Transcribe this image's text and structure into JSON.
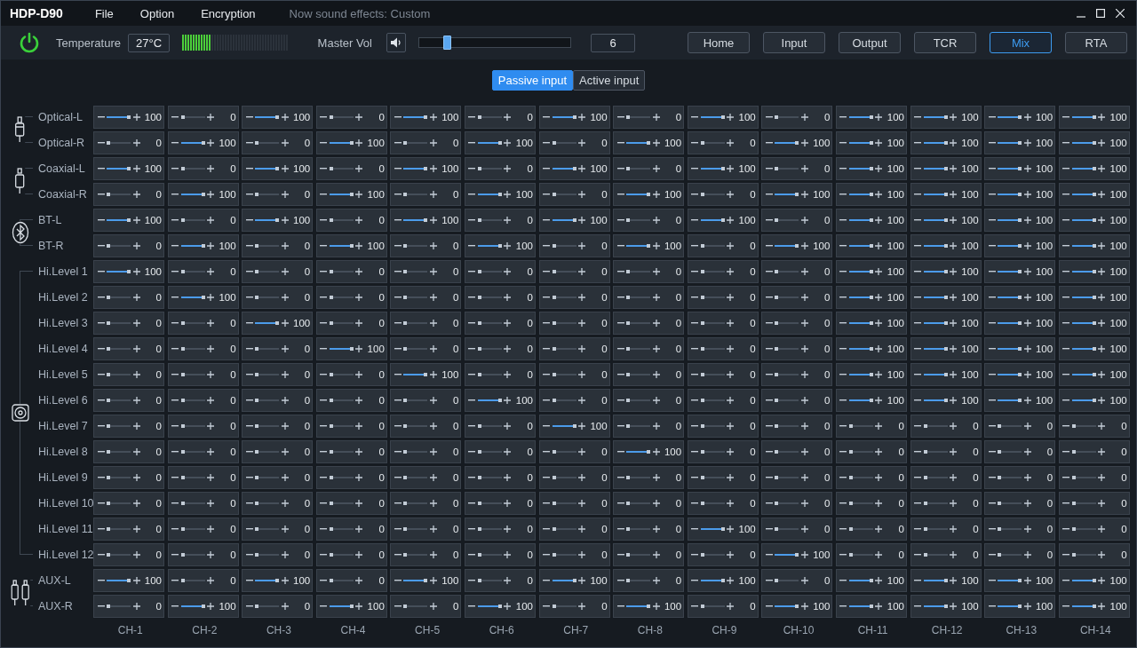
{
  "window": {
    "title": "HDP-D90",
    "menu": [
      "File",
      "Option",
      "Encryption"
    ],
    "status": "Now sound effects: Custom"
  },
  "toolbar": {
    "temperature_label": "Temperature",
    "temperature": "27°C",
    "temperature_meter": {
      "level": 0.27
    },
    "master_label": "Master Vol",
    "master_volume": {
      "level": 0.18,
      "value": "6"
    },
    "nav": [
      {
        "label": "Home",
        "selected": false
      },
      {
        "label": "Input",
        "selected": false
      },
      {
        "label": "Output",
        "selected": false
      },
      {
        "label": "TCR",
        "selected": false
      },
      {
        "label": "Mix",
        "selected": true
      },
      {
        "label": "RTA",
        "selected": false
      }
    ]
  },
  "tabs": [
    {
      "label": "Passive input",
      "selected": true
    },
    {
      "label": "Active input",
      "selected": false
    }
  ],
  "groups": [
    {
      "kind": "optical",
      "rows": [
        {
          "label": "Optical-L",
          "cells": [
            {
              "value": "100",
              "level": 1
            },
            {
              "value": "0",
              "level": 0
            },
            {
              "value": "100",
              "level": 1
            },
            {
              "value": "0",
              "level": 0
            },
            {
              "value": "100",
              "level": 1
            },
            {
              "value": "0",
              "level": 0
            },
            {
              "value": "100",
              "level": 1
            },
            {
              "value": "0",
              "level": 0
            },
            {
              "value": "100",
              "level": 1
            },
            {
              "value": "0",
              "level": 0
            },
            {
              "value": "100",
              "level": 1
            },
            {
              "value": "100",
              "level": 1
            },
            {
              "value": "100",
              "level": 1
            },
            {
              "value": "100",
              "level": 1
            }
          ]
        },
        {
          "label": "Optical-R",
          "cells": [
            {
              "value": "0",
              "level": 0
            },
            {
              "value": "100",
              "level": 1
            },
            {
              "value": "0",
              "level": 0
            },
            {
              "value": "100",
              "level": 1
            },
            {
              "value": "0",
              "level": 0
            },
            {
              "value": "100",
              "level": 1
            },
            {
              "value": "0",
              "level": 0
            },
            {
              "value": "100",
              "level": 1
            },
            {
              "value": "0",
              "level": 0
            },
            {
              "value": "100",
              "level": 1
            },
            {
              "value": "100",
              "level": 1
            },
            {
              "value": "100",
              "level": 1
            },
            {
              "value": "100",
              "level": 1
            },
            {
              "value": "100",
              "level": 1
            }
          ]
        }
      ]
    },
    {
      "kind": "coaxial",
      "rows": [
        {
          "label": "Coaxial-L",
          "cells": [
            {
              "value": "100",
              "level": 1
            },
            {
              "value": "0",
              "level": 0
            },
            {
              "value": "100",
              "level": 1
            },
            {
              "value": "0",
              "level": 0
            },
            {
              "value": "100",
              "level": 1
            },
            {
              "value": "0",
              "level": 0
            },
            {
              "value": "100",
              "level": 1
            },
            {
              "value": "0",
              "level": 0
            },
            {
              "value": "100",
              "level": 1
            },
            {
              "value": "0",
              "level": 0
            },
            {
              "value": "100",
              "level": 1
            },
            {
              "value": "100",
              "level": 1
            },
            {
              "value": "100",
              "level": 1
            },
            {
              "value": "100",
              "level": 1
            }
          ]
        },
        {
          "label": "Coaxial-R",
          "cells": [
            {
              "value": "0",
              "level": 0
            },
            {
              "value": "100",
              "level": 1
            },
            {
              "value": "0",
              "level": 0
            },
            {
              "value": "100",
              "level": 1
            },
            {
              "value": "0",
              "level": 0
            },
            {
              "value": "100",
              "level": 1
            },
            {
              "value": "0",
              "level": 0
            },
            {
              "value": "100",
              "level": 1
            },
            {
              "value": "0",
              "level": 0
            },
            {
              "value": "100",
              "level": 1
            },
            {
              "value": "100",
              "level": 1
            },
            {
              "value": "100",
              "level": 1
            },
            {
              "value": "100",
              "level": 1
            },
            {
              "value": "100",
              "level": 1
            }
          ]
        }
      ]
    },
    {
      "kind": "bluetooth",
      "rows": [
        {
          "label": "BT-L",
          "cells": [
            {
              "value": "100",
              "level": 1
            },
            {
              "value": "0",
              "level": 0
            },
            {
              "value": "100",
              "level": 1
            },
            {
              "value": "0",
              "level": 0
            },
            {
              "value": "100",
              "level": 1
            },
            {
              "value": "0",
              "level": 0
            },
            {
              "value": "100",
              "level": 1
            },
            {
              "value": "0",
              "level": 0
            },
            {
              "value": "100",
              "level": 1
            },
            {
              "value": "0",
              "level": 0
            },
            {
              "value": "100",
              "level": 1
            },
            {
              "value": "100",
              "level": 1
            },
            {
              "value": "100",
              "level": 1
            },
            {
              "value": "100",
              "level": 1
            }
          ]
        },
        {
          "label": "BT-R",
          "cells": [
            {
              "value": "0",
              "level": 0
            },
            {
              "value": "100",
              "level": 1
            },
            {
              "value": "0",
              "level": 0
            },
            {
              "value": "100",
              "level": 1
            },
            {
              "value": "0",
              "level": 0
            },
            {
              "value": "100",
              "level": 1
            },
            {
              "value": "0",
              "level": 0
            },
            {
              "value": "100",
              "level": 1
            },
            {
              "value": "0",
              "level": 0
            },
            {
              "value": "100",
              "level": 1
            },
            {
              "value": "100",
              "level": 1
            },
            {
              "value": "100",
              "level": 1
            },
            {
              "value": "100",
              "level": 1
            },
            {
              "value": "100",
              "level": 1
            }
          ]
        }
      ]
    },
    {
      "kind": "speaker",
      "rows": [
        {
          "label": "Hi.Level 1",
          "cells": [
            {
              "value": "100",
              "level": 1
            },
            {
              "value": "0",
              "level": 0
            },
            {
              "value": "0",
              "level": 0
            },
            {
              "value": "0",
              "level": 0
            },
            {
              "value": "0",
              "level": 0
            },
            {
              "value": "0",
              "level": 0
            },
            {
              "value": "0",
              "level": 0
            },
            {
              "value": "0",
              "level": 0
            },
            {
              "value": "0",
              "level": 0
            },
            {
              "value": "0",
              "level": 0
            },
            {
              "value": "100",
              "level": 1
            },
            {
              "value": "100",
              "level": 1
            },
            {
              "value": "100",
              "level": 1
            },
            {
              "value": "100",
              "level": 1
            }
          ]
        },
        {
          "label": "Hi.Level 2",
          "cells": [
            {
              "value": "0",
              "level": 0
            },
            {
              "value": "100",
              "level": 1
            },
            {
              "value": "0",
              "level": 0
            },
            {
              "value": "0",
              "level": 0
            },
            {
              "value": "0",
              "level": 0
            },
            {
              "value": "0",
              "level": 0
            },
            {
              "value": "0",
              "level": 0
            },
            {
              "value": "0",
              "level": 0
            },
            {
              "value": "0",
              "level": 0
            },
            {
              "value": "0",
              "level": 0
            },
            {
              "value": "100",
              "level": 1
            },
            {
              "value": "100",
              "level": 1
            },
            {
              "value": "100",
              "level": 1
            },
            {
              "value": "100",
              "level": 1
            }
          ]
        },
        {
          "label": "Hi.Level 3",
          "cells": [
            {
              "value": "0",
              "level": 0
            },
            {
              "value": "0",
              "level": 0
            },
            {
              "value": "100",
              "level": 1
            },
            {
              "value": "0",
              "level": 0
            },
            {
              "value": "0",
              "level": 0
            },
            {
              "value": "0",
              "level": 0
            },
            {
              "value": "0",
              "level": 0
            },
            {
              "value": "0",
              "level": 0
            },
            {
              "value": "0",
              "level": 0
            },
            {
              "value": "0",
              "level": 0
            },
            {
              "value": "100",
              "level": 1
            },
            {
              "value": "100",
              "level": 1
            },
            {
              "value": "100",
              "level": 1
            },
            {
              "value": "100",
              "level": 1
            }
          ]
        },
        {
          "label": "Hi.Level 4",
          "cells": [
            {
              "value": "0",
              "level": 0
            },
            {
              "value": "0",
              "level": 0
            },
            {
              "value": "0",
              "level": 0
            },
            {
              "value": "100",
              "level": 1
            },
            {
              "value": "0",
              "level": 0
            },
            {
              "value": "0",
              "level": 0
            },
            {
              "value": "0",
              "level": 0
            },
            {
              "value": "0",
              "level": 0
            },
            {
              "value": "0",
              "level": 0
            },
            {
              "value": "0",
              "level": 0
            },
            {
              "value": "100",
              "level": 1
            },
            {
              "value": "100",
              "level": 1
            },
            {
              "value": "100",
              "level": 1
            },
            {
              "value": "100",
              "level": 1
            }
          ]
        },
        {
          "label": "Hi.Level 5",
          "cells": [
            {
              "value": "0",
              "level": 0
            },
            {
              "value": "0",
              "level": 0
            },
            {
              "value": "0",
              "level": 0
            },
            {
              "value": "0",
              "level": 0
            },
            {
              "value": "100",
              "level": 1
            },
            {
              "value": "0",
              "level": 0
            },
            {
              "value": "0",
              "level": 0
            },
            {
              "value": "0",
              "level": 0
            },
            {
              "value": "0",
              "level": 0
            },
            {
              "value": "0",
              "level": 0
            },
            {
              "value": "100",
              "level": 1
            },
            {
              "value": "100",
              "level": 1
            },
            {
              "value": "100",
              "level": 1
            },
            {
              "value": "100",
              "level": 1
            }
          ]
        },
        {
          "label": "Hi.Level 6",
          "cells": [
            {
              "value": "0",
              "level": 0
            },
            {
              "value": "0",
              "level": 0
            },
            {
              "value": "0",
              "level": 0
            },
            {
              "value": "0",
              "level": 0
            },
            {
              "value": "0",
              "level": 0
            },
            {
              "value": "100",
              "level": 1
            },
            {
              "value": "0",
              "level": 0
            },
            {
              "value": "0",
              "level": 0
            },
            {
              "value": "0",
              "level": 0
            },
            {
              "value": "0",
              "level": 0
            },
            {
              "value": "100",
              "level": 1
            },
            {
              "value": "100",
              "level": 1
            },
            {
              "value": "100",
              "level": 1
            },
            {
              "value": "100",
              "level": 1
            }
          ]
        },
        {
          "label": "Hi.Level 7",
          "cells": [
            {
              "value": "0",
              "level": 0
            },
            {
              "value": "0",
              "level": 0
            },
            {
              "value": "0",
              "level": 0
            },
            {
              "value": "0",
              "level": 0
            },
            {
              "value": "0",
              "level": 0
            },
            {
              "value": "0",
              "level": 0
            },
            {
              "value": "100",
              "level": 1
            },
            {
              "value": "0",
              "level": 0
            },
            {
              "value": "0",
              "level": 0
            },
            {
              "value": "0",
              "level": 0
            },
            {
              "value": "0",
              "level": 0
            },
            {
              "value": "0",
              "level": 0
            },
            {
              "value": "0",
              "level": 0
            },
            {
              "value": "0",
              "level": 0
            }
          ]
        },
        {
          "label": "Hi.Level 8",
          "cells": [
            {
              "value": "0",
              "level": 0
            },
            {
              "value": "0",
              "level": 0
            },
            {
              "value": "0",
              "level": 0
            },
            {
              "value": "0",
              "level": 0
            },
            {
              "value": "0",
              "level": 0
            },
            {
              "value": "0",
              "level": 0
            },
            {
              "value": "0",
              "level": 0
            },
            {
              "value": "100",
              "level": 1
            },
            {
              "value": "0",
              "level": 0
            },
            {
              "value": "0",
              "level": 0
            },
            {
              "value": "0",
              "level": 0
            },
            {
              "value": "0",
              "level": 0
            },
            {
              "value": "0",
              "level": 0
            },
            {
              "value": "0",
              "level": 0
            }
          ]
        },
        {
          "label": "Hi.Level 9",
          "cells": [
            {
              "value": "0",
              "level": 0
            },
            {
              "value": "0",
              "level": 0
            },
            {
              "value": "0",
              "level": 0
            },
            {
              "value": "0",
              "level": 0
            },
            {
              "value": "0",
              "level": 0
            },
            {
              "value": "0",
              "level": 0
            },
            {
              "value": "0",
              "level": 0
            },
            {
              "value": "0",
              "level": 0
            },
            {
              "value": "0",
              "level": 0
            },
            {
              "value": "0",
              "level": 0
            },
            {
              "value": "0",
              "level": 0
            },
            {
              "value": "0",
              "level": 0
            },
            {
              "value": "0",
              "level": 0
            },
            {
              "value": "0",
              "level": 0
            }
          ]
        },
        {
          "label": "Hi.Level 10",
          "cells": [
            {
              "value": "0",
              "level": 0
            },
            {
              "value": "0",
              "level": 0
            },
            {
              "value": "0",
              "level": 0
            },
            {
              "value": "0",
              "level": 0
            },
            {
              "value": "0",
              "level": 0
            },
            {
              "value": "0",
              "level": 0
            },
            {
              "value": "0",
              "level": 0
            },
            {
              "value": "0",
              "level": 0
            },
            {
              "value": "0",
              "level": 0
            },
            {
              "value": "0",
              "level": 0
            },
            {
              "value": "0",
              "level": 0
            },
            {
              "value": "0",
              "level": 0
            },
            {
              "value": "0",
              "level": 0
            },
            {
              "value": "0",
              "level": 0
            }
          ]
        },
        {
          "label": "Hi.Level 11",
          "cells": [
            {
              "value": "0",
              "level": 0
            },
            {
              "value": "0",
              "level": 0
            },
            {
              "value": "0",
              "level": 0
            },
            {
              "value": "0",
              "level": 0
            },
            {
              "value": "0",
              "level": 0
            },
            {
              "value": "0",
              "level": 0
            },
            {
              "value": "0",
              "level": 0
            },
            {
              "value": "0",
              "level": 0
            },
            {
              "value": "100",
              "level": 1
            },
            {
              "value": "0",
              "level": 0
            },
            {
              "value": "0",
              "level": 0
            },
            {
              "value": "0",
              "level": 0
            },
            {
              "value": "0",
              "level": 0
            },
            {
              "value": "0",
              "level": 0
            }
          ]
        },
        {
          "label": "Hi.Level 12",
          "cells": [
            {
              "value": "0",
              "level": 0
            },
            {
              "value": "0",
              "level": 0
            },
            {
              "value": "0",
              "level": 0
            },
            {
              "value": "0",
              "level": 0
            },
            {
              "value": "0",
              "level": 0
            },
            {
              "value": "0",
              "level": 0
            },
            {
              "value": "0",
              "level": 0
            },
            {
              "value": "0",
              "level": 0
            },
            {
              "value": "0",
              "level": 0
            },
            {
              "value": "100",
              "level": 1
            },
            {
              "value": "0",
              "level": 0
            },
            {
              "value": "0",
              "level": 0
            },
            {
              "value": "0",
              "level": 0
            },
            {
              "value": "0",
              "level": 0
            }
          ]
        }
      ]
    },
    {
      "kind": "aux",
      "rows": [
        {
          "label": "AUX-L",
          "cells": [
            {
              "value": "100",
              "level": 1
            },
            {
              "value": "0",
              "level": 0
            },
            {
              "value": "100",
              "level": 1
            },
            {
              "value": "0",
              "level": 0
            },
            {
              "value": "100",
              "level": 1
            },
            {
              "value": "0",
              "level": 0
            },
            {
              "value": "100",
              "level": 1
            },
            {
              "value": "0",
              "level": 0
            },
            {
              "value": "100",
              "level": 1
            },
            {
              "value": "0",
              "level": 0
            },
            {
              "value": "100",
              "level": 1
            },
            {
              "value": "100",
              "level": 1
            },
            {
              "value": "100",
              "level": 1
            },
            {
              "value": "100",
              "level": 1
            }
          ]
        },
        {
          "label": "AUX-R",
          "cells": [
            {
              "value": "0",
              "level": 0
            },
            {
              "value": "100",
              "level": 1
            },
            {
              "value": "0",
              "level": 0
            },
            {
              "value": "100",
              "level": 1
            },
            {
              "value": "0",
              "level": 0
            },
            {
              "value": "100",
              "level": 1
            },
            {
              "value": "0",
              "level": 0
            },
            {
              "value": "100",
              "level": 1
            },
            {
              "value": "0",
              "level": 0
            },
            {
              "value": "100",
              "level": 1
            },
            {
              "value": "100",
              "level": 1
            },
            {
              "value": "100",
              "level": 1
            },
            {
              "value": "100",
              "level": 1
            },
            {
              "value": "100",
              "level": 1
            }
          ]
        }
      ]
    }
  ],
  "channels": [
    "CH-1",
    "CH-2",
    "CH-3",
    "CH-4",
    "CH-5",
    "CH-6",
    "CH-7",
    "CH-8",
    "CH-9",
    "CH-10",
    "CH-11",
    "CH-12",
    "CH-13",
    "CH-14"
  ]
}
